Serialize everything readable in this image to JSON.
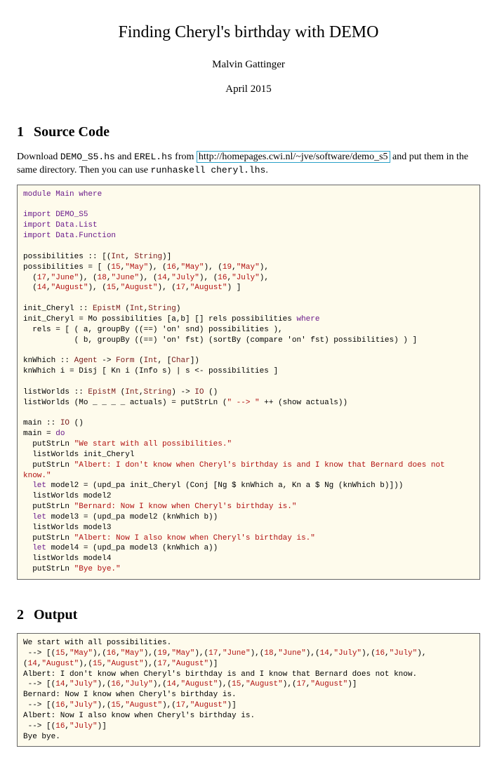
{
  "title": "Finding Cheryl's birthday with DEMO",
  "author": "Malvin Gattinger",
  "date": "April 2015",
  "section1": {
    "num": "1",
    "heading": "Source Code",
    "para_pre": "Download ",
    "file1": "DEMO_S5.hs",
    "para_mid1": " and ",
    "file2": "EREL.hs",
    "para_mid2": " from ",
    "url": "http://homepages.cwi.nl/~jve/software/demo_s5",
    "para_mid3": " and put them in the same directory. Then you can use ",
    "cmd": "runhaskell cheryl.lhs",
    "para_end": "."
  },
  "code1_lines": {
    "l01": "module Main where",
    "l02": "",
    "l03": "import DEMO_S5",
    "l04": "import Data.List",
    "l05": "import Data.Function",
    "l06": "",
    "l07": "possibilities :: [(Int, String)]",
    "l08": "possibilities = [ (15,\"May\"), (16,\"May\"), (19,\"May\"),",
    "l09": "  (17,\"June\"), (18,\"June\"), (14,\"July\"), (16,\"July\"),",
    "l10": "  (14,\"August\"), (15,\"August\"), (17,\"August\") ]",
    "l11": "",
    "l12": "init_Cheryl :: EpistM (Int,String)",
    "l13": "init_Cheryl = Mo possibilities [a,b] [] rels possibilities where",
    "l14": "  rels = [ ( a, groupBy ((==) 'on' snd) possibilities ),",
    "l15": "           ( b, groupBy ((==) 'on' fst) (sortBy (compare 'on' fst) possibilities) ) ]",
    "l16": "",
    "l17": "knWhich :: Agent -> Form (Int, [Char])",
    "l18": "knWhich i = Disj [ Kn i (Info s) | s <- possibilities ]",
    "l19": "",
    "l20": "listWorlds :: EpistM (Int,String) -> IO ()",
    "l21": "listWorlds (Mo _ _ _ _ actuals) = putStrLn (\" --> \" ++ (show actuals))",
    "l22": "",
    "l23": "main :: IO ()",
    "l24": "main = do",
    "l25": "  putStrLn \"We start with all possibilities.\"",
    "l26": "  listWorlds init_Cheryl",
    "l27a": "  putStrLn ",
    "l27b": "\"Albert: I don't know when Cheryl's birthday is and I know that Bernard does not know.\"",
    "l28": "  let model2 = (upd_pa init_Cheryl (Conj [Ng $ knWhich a, Kn a $ Ng (knWhich b)]))",
    "l29": "  listWorlds model2",
    "l30": "  putStrLn \"Bernard: Now I know when Cheryl's birthday is.\"",
    "l31": "  let model3 = (upd_pa model2 (knWhich b))",
    "l32": "  listWorlds model3",
    "l33": "  putStrLn \"Albert: Now I also know when Cheryl's birthday is.\"",
    "l34": "  let model4 = (upd_pa model3 (knWhich a))",
    "l35": "  listWorlds model4",
    "l36": "  putStrLn \"Bye bye.\""
  },
  "section2": {
    "num": "2",
    "heading": "Output"
  },
  "code2_lines": {
    "l01": "We start with all possibilities.",
    "l02": " --> [(15,\"May\"),(16,\"May\"),(19,\"May\"),(17,\"June\"),(18,\"June\"),(14,\"July\"),(16,\"July\"),(14,\"August\"),(15,\"August\"),(17,\"August\")]",
    "l03": "Albert: I don't know when Cheryl's birthday is and I know that Bernard does not know.",
    "l04": " --> [(14,\"July\"),(16,\"July\"),(14,\"August\"),(15,\"August\"),(17,\"August\")]",
    "l05": "Bernard: Now I know when Cheryl's birthday is.",
    "l06": " --> [(16,\"July\"),(15,\"August\"),(17,\"August\")]",
    "l07": "Albert: Now I also know when Cheryl's birthday is.",
    "l08": " --> [(16,\"July\")]",
    "l09": "Bye bye."
  }
}
